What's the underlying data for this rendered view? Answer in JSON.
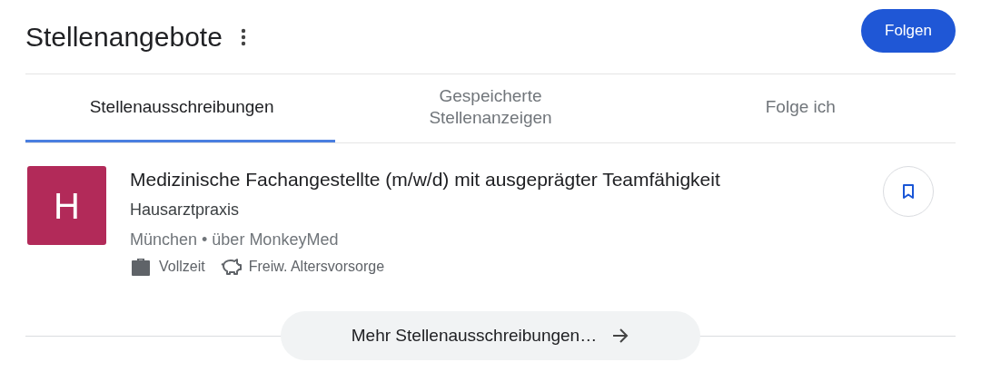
{
  "header": {
    "title": "Stellenangebote",
    "follow_button": "Folgen"
  },
  "tabs": [
    {
      "label": "Stellenausschreibungen",
      "selected": true
    },
    {
      "label": "Gespeicherte Stellenanzeigen",
      "selected": false
    },
    {
      "label": "Folge ich",
      "selected": false
    }
  ],
  "jobs": [
    {
      "logo_letter": "H",
      "color": "#b22a59",
      "title": "Medizinische Fachangestellte (m/w/d) mit ausgeprägter Teamfähigkeit",
      "company": "Hausarztpraxis",
      "location": "München • über MonkeyMed",
      "saved": false,
      "features": [
        {
          "kind": "employment",
          "label": "Vollzeit"
        },
        {
          "kind": "benefit",
          "label": "Freiw. Altersvorsorge"
        }
      ]
    }
  ],
  "more_button": "Mehr Stellenausschreibungen…"
}
